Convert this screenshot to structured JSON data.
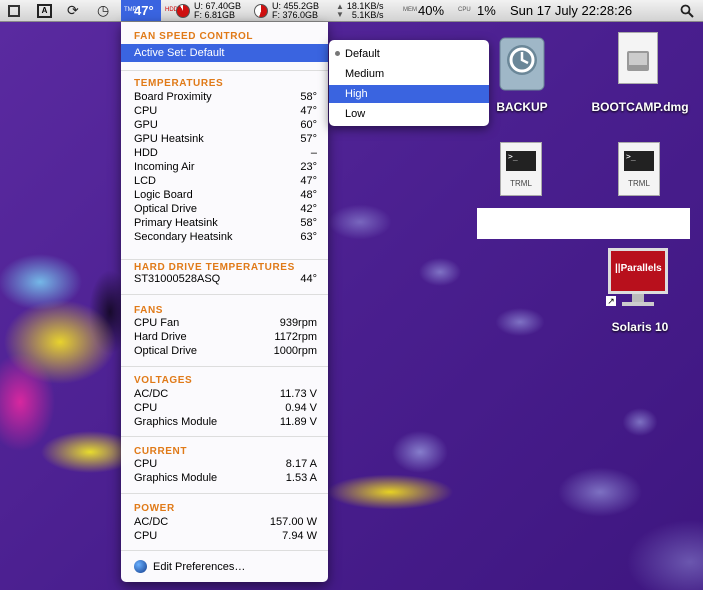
{
  "menubar": {
    "temp_value": "47°",
    "disk_used": "U: 67.40GB",
    "disk_free": "F: 6.81GB",
    "disk2_used": "U: 455.2GB",
    "disk2_free": "F: 376.0GB",
    "net_up": "18.1KB/s",
    "net_down": "5.1KB/s",
    "mem_pct": "40%",
    "cpu_pct": "1%",
    "clock": "Sun 17 July 22:28:26",
    "tmp_vert": "TMP",
    "hdd_vert": "HDD",
    "mem_vert": "MEM",
    "cpu_vert": "CPU"
  },
  "fan_control": {
    "header": "FAN SPEED CONTROL",
    "active_set": "Active Set: Default"
  },
  "submenu": {
    "items": [
      {
        "label": "Default",
        "checked": true
      },
      {
        "label": "Medium",
        "checked": false
      },
      {
        "label": "High",
        "checked": false,
        "highlighted": true
      },
      {
        "label": "Low",
        "checked": false
      }
    ]
  },
  "temperatures": {
    "header": "TEMPERATURES",
    "rows": [
      {
        "label": "Board Proximity",
        "value": "58°"
      },
      {
        "label": "CPU",
        "value": "47°"
      },
      {
        "label": "GPU",
        "value": "60°"
      },
      {
        "label": "GPU Heatsink",
        "value": "57°"
      },
      {
        "label": "HDD",
        "value": "–"
      },
      {
        "label": "Incoming Air",
        "value": "23°"
      },
      {
        "label": "LCD",
        "value": "47°"
      },
      {
        "label": "Logic Board",
        "value": "48°"
      },
      {
        "label": "Optical Drive",
        "value": "42°"
      },
      {
        "label": "Primary Heatsink",
        "value": "58°"
      },
      {
        "label": "Secondary Heatsink",
        "value": "63°"
      }
    ]
  },
  "hdd_temps": {
    "header": "HARD DRIVE TEMPERATURES",
    "rows": [
      {
        "label": "ST31000528ASQ",
        "value": "44°"
      }
    ]
  },
  "fans": {
    "header": "FANS",
    "rows": [
      {
        "label": "CPU Fan",
        "value": "939rpm"
      },
      {
        "label": "Hard Drive",
        "value": "1172rpm"
      },
      {
        "label": "Optical Drive",
        "value": "1000rpm"
      }
    ]
  },
  "voltages": {
    "header": "VOLTAGES",
    "rows": [
      {
        "label": "AC/DC",
        "value": "11.73 V"
      },
      {
        "label": "CPU",
        "value": "0.94 V"
      },
      {
        "label": "Graphics Module",
        "value": "11.89 V"
      }
    ]
  },
  "current": {
    "header": "CURRENT",
    "rows": [
      {
        "label": "CPU",
        "value": "8.17 A"
      },
      {
        "label": "Graphics Module",
        "value": "1.53 A"
      }
    ]
  },
  "power": {
    "header": "POWER",
    "rows": [
      {
        "label": "AC/DC",
        "value": "157.00 W"
      },
      {
        "label": "CPU",
        "value": "7.94 W"
      }
    ]
  },
  "edit_prefs": "Edit Preferences…",
  "desktop": {
    "backup": "BACKUP",
    "bootcamp": "BOOTCAMP.dmg",
    "trml_1": "TRML",
    "trml_2": "TRML",
    "solaris": "Solaris 10",
    "parallels_logo": "||Parallels"
  }
}
